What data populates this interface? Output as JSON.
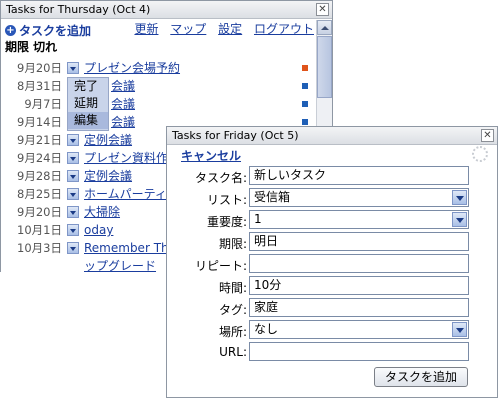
{
  "thursday": {
    "title": "Tasks for Thursday (Oct 4)",
    "close_label": "✕",
    "add_task_label": "タスクを追加",
    "add_icon_glyph": "+",
    "links": [
      "更新",
      "マップ",
      "設定",
      "ログアウト"
    ],
    "section_title": "期限 切れ",
    "tasks": [
      {
        "date": "9月20日",
        "name": "プレゼン会場予約",
        "priority_color": "#e0541b"
      },
      {
        "date": "8月31日",
        "name": "会議",
        "priority_color": "#1f5fb6"
      },
      {
        "date": "9月7日",
        "name": "会議",
        "priority_color": "#1f5fb6"
      },
      {
        "date": "9月14日",
        "name": "会議",
        "priority_color": "#1f5fb6"
      },
      {
        "date": "9月21日",
        "name": "定例会議",
        "priority_color": "#1f5fb6"
      },
      {
        "date": "9月24日",
        "name": "プレゼン資料作",
        "priority_color": ""
      },
      {
        "date": "9月28日",
        "name": "定例会議",
        "priority_color": ""
      },
      {
        "date": "8月25日",
        "name": "ホームパーティ",
        "priority_color": ""
      },
      {
        "date": "9月20日",
        "name": "大掃除",
        "priority_color": ""
      },
      {
        "date": "10月1日",
        "name": "oday",
        "priority_color": ""
      },
      {
        "date": "10月3日",
        "name": "Remember The",
        "priority_color": ""
      },
      {
        "date": "",
        "name": "ップグレード",
        "priority_color": ""
      }
    ],
    "task_menu": [
      "完了",
      "延期",
      "編集"
    ]
  },
  "friday": {
    "title": "Tasks for Friday (Oct 5)",
    "close_label": "✕",
    "cancel_label": "キャンセル",
    "fields": {
      "name": {
        "label": "タスク名:",
        "value": "新しいタスク"
      },
      "list": {
        "label": "リスト:",
        "value": "受信箱"
      },
      "priority": {
        "label": "重要度:",
        "value": "1"
      },
      "due": {
        "label": "期限:",
        "value": "明日"
      },
      "repeat": {
        "label": "リピート:",
        "value": ""
      },
      "estimate": {
        "label": "時間:",
        "value": "10分"
      },
      "tags": {
        "label": "タグ:",
        "value": "家庭"
      },
      "location": {
        "label": "場所:",
        "value": "なし"
      },
      "url": {
        "label": "URL:",
        "value": ""
      }
    },
    "submit_label": "タスクを追加"
  }
}
